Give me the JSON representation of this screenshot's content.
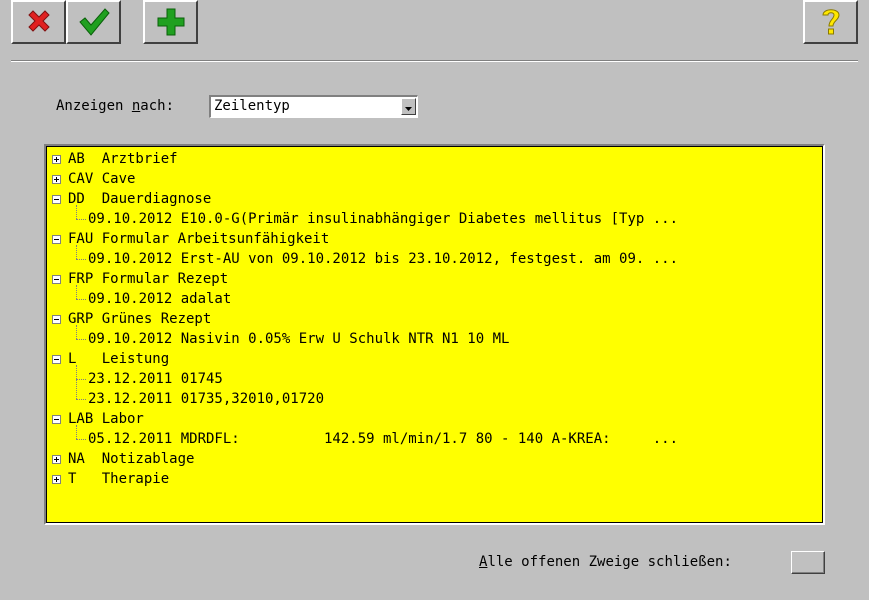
{
  "toolbar": {
    "cancel_icon": "red-x-icon",
    "ok_icon": "green-check-icon",
    "add_icon": "green-plus-icon",
    "help_icon": "yellow-question-icon"
  },
  "filter": {
    "label_pre": "Anzeigen ",
    "label_accel": "n",
    "label_post": "ach:",
    "selected": "Zeilentyp"
  },
  "tree": {
    "background": "#ffff00",
    "nodes": [
      {
        "label": "AB  Arztbrief",
        "expanded": false,
        "children": []
      },
      {
        "label": "CAV Cave",
        "expanded": false,
        "children": []
      },
      {
        "label": "DD  Dauerdiagnose",
        "expanded": true,
        "children": [
          "09.10.2012 E10.0-G(Primär insulinabhängiger Diabetes mellitus [Typ ..."
        ]
      },
      {
        "label": "FAU Formular Arbeitsunfähigkeit",
        "expanded": true,
        "children": [
          "09.10.2012 Erst-AU von 09.10.2012 bis 23.10.2012, festgest. am 09. ..."
        ]
      },
      {
        "label": "FRP Formular Rezept",
        "expanded": true,
        "children": [
          "09.10.2012 adalat"
        ]
      },
      {
        "label": "GRP Grünes Rezept",
        "expanded": true,
        "children": [
          "09.10.2012 Nasivin 0.05% Erw U Schulk NTR N1 10 ML"
        ]
      },
      {
        "label": "L   Leistung",
        "expanded": true,
        "children": [
          "23.12.2011 01745",
          "23.12.2011 01735,32010,01720"
        ]
      },
      {
        "label": "LAB Labor",
        "expanded": true,
        "children": [
          "05.12.2011 MDRDFL:          142.59 ml/min/1.7 80 - 140 A-KREA:     ..."
        ]
      },
      {
        "label": "NA  Notizablage",
        "expanded": false,
        "children": []
      },
      {
        "label": "T   Therapie",
        "expanded": false,
        "children": []
      }
    ]
  },
  "bottom": {
    "label_accel": "A",
    "label_post": "lle offenen Zweige schließen:"
  }
}
